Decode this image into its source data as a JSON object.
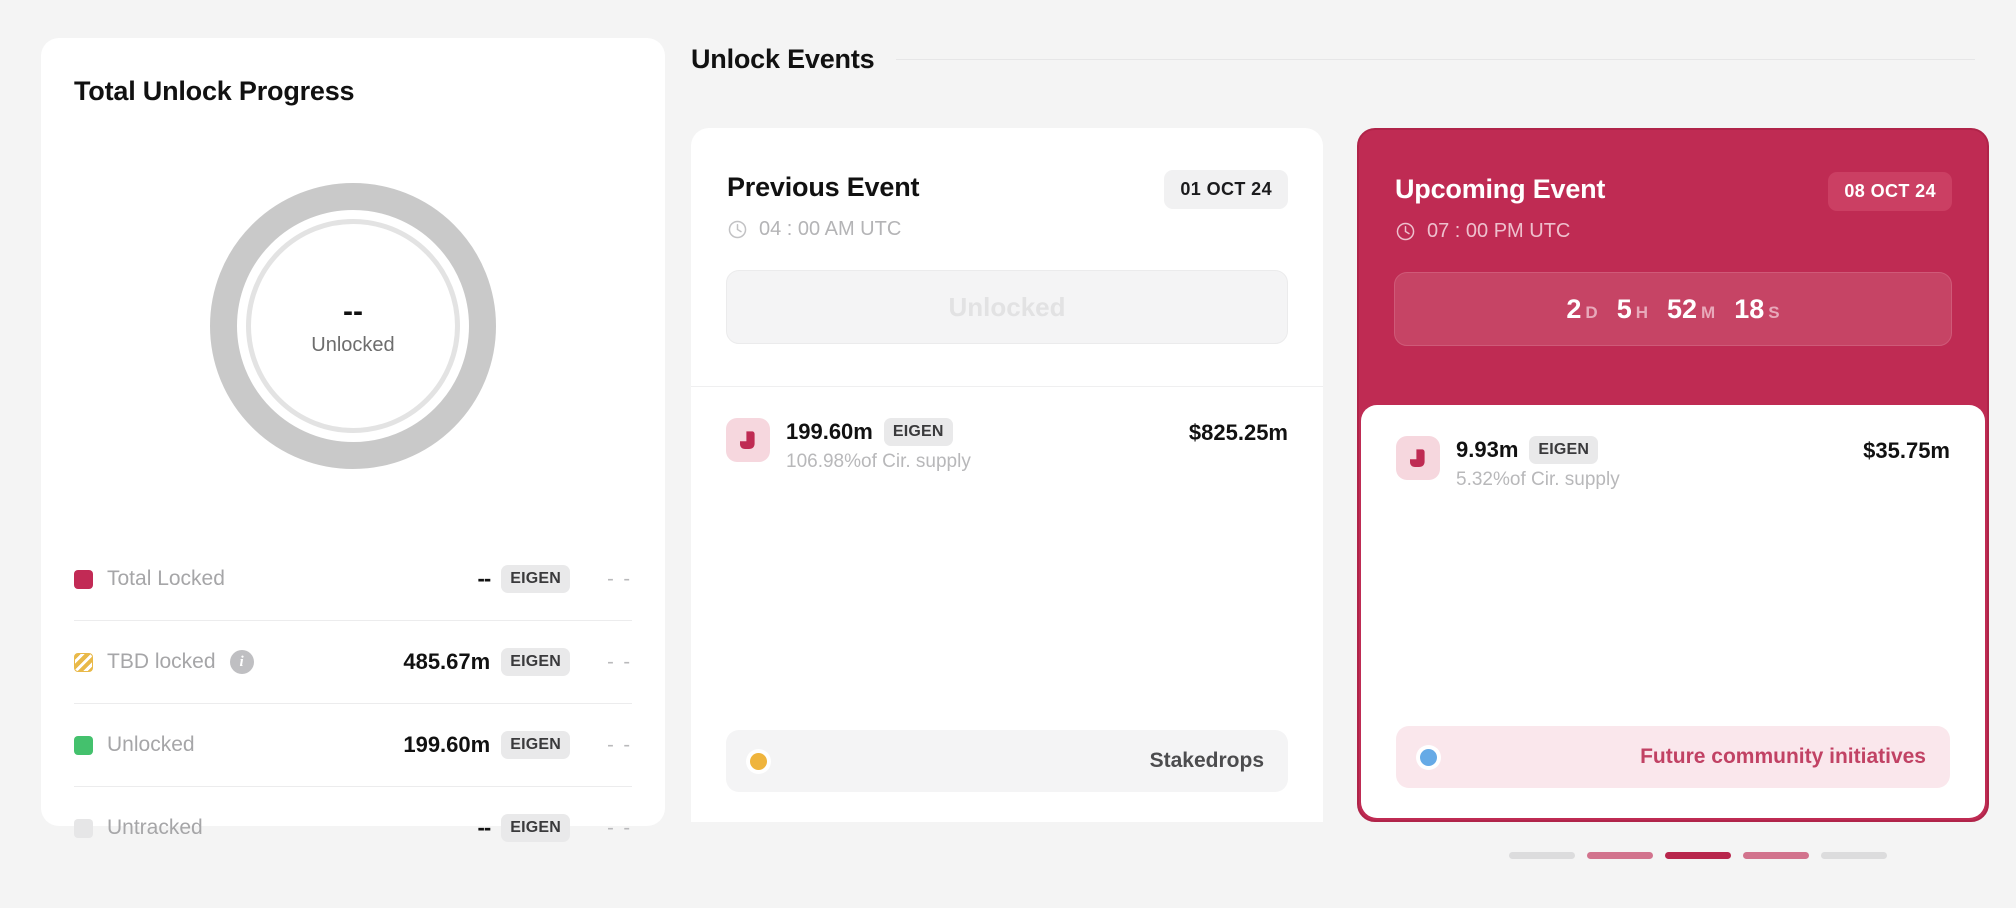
{
  "progress": {
    "title": "Total Unlock Progress",
    "donut": {
      "value": "--",
      "label": "Unlocked",
      "track_color": "#c9c9c9",
      "inner_ring_color": "#e3e3e3"
    },
    "legend": [
      {
        "name": "Total Locked",
        "swatch_color": "#c22a55",
        "swatch_style": "solid",
        "has_info_icon": false,
        "amount": "--",
        "ticker": "EIGEN",
        "secondary": "- -"
      },
      {
        "name": "TBD locked",
        "swatch_color": "#e9b949",
        "swatch_style": "striped",
        "has_info_icon": true,
        "amount": "485.67m",
        "ticker": "EIGEN",
        "secondary": "- -"
      },
      {
        "name": "Unlocked",
        "swatch_color": "#44c16d",
        "swatch_style": "solid",
        "has_info_icon": false,
        "amount": "199.60m",
        "ticker": "EIGEN",
        "secondary": "- -"
      },
      {
        "name": "Untracked",
        "swatch_color": "#e6e6e7",
        "swatch_style": "solid",
        "has_info_icon": false,
        "amount": "--",
        "ticker": "EIGEN",
        "secondary": "- -"
      }
    ]
  },
  "events_section": {
    "heading": "Unlock Events"
  },
  "previous_event": {
    "title": "Previous Event",
    "date_badge": "01 OCT 24",
    "time": "04 : 00 AM UTC",
    "status_label": "Unlocked",
    "token": {
      "amount": "199.60m",
      "ticker": "EIGEN",
      "percent": "106.98%of Cir. supply",
      "usd": "$825.25m"
    },
    "tag": {
      "label": "Stakedrops",
      "dot_color": "#efb43c"
    }
  },
  "upcoming_event": {
    "title": "Upcoming Event",
    "date_badge": "08 OCT 24",
    "time": "07 : 00 PM UTC",
    "countdown": {
      "days_value": "2",
      "days_unit": "D",
      "hours_value": "5",
      "hours_unit": "H",
      "minutes_value": "52",
      "minutes_unit": "M",
      "seconds_value": "18",
      "seconds_unit": "S"
    },
    "token": {
      "amount": "9.93m",
      "ticker": "EIGEN",
      "percent": "5.32%of Cir. supply",
      "usd": "$35.75m"
    },
    "tag": {
      "label": "Future community initiatives",
      "dot_color": "#66aae6"
    }
  },
  "pagination": {
    "bars": [
      {
        "color": "#dcdcdd"
      },
      {
        "color": "#d2738d"
      },
      {
        "color": "#b8264c"
      },
      {
        "color": "#d2738d"
      },
      {
        "color": "#dcdcdd"
      }
    ]
  }
}
